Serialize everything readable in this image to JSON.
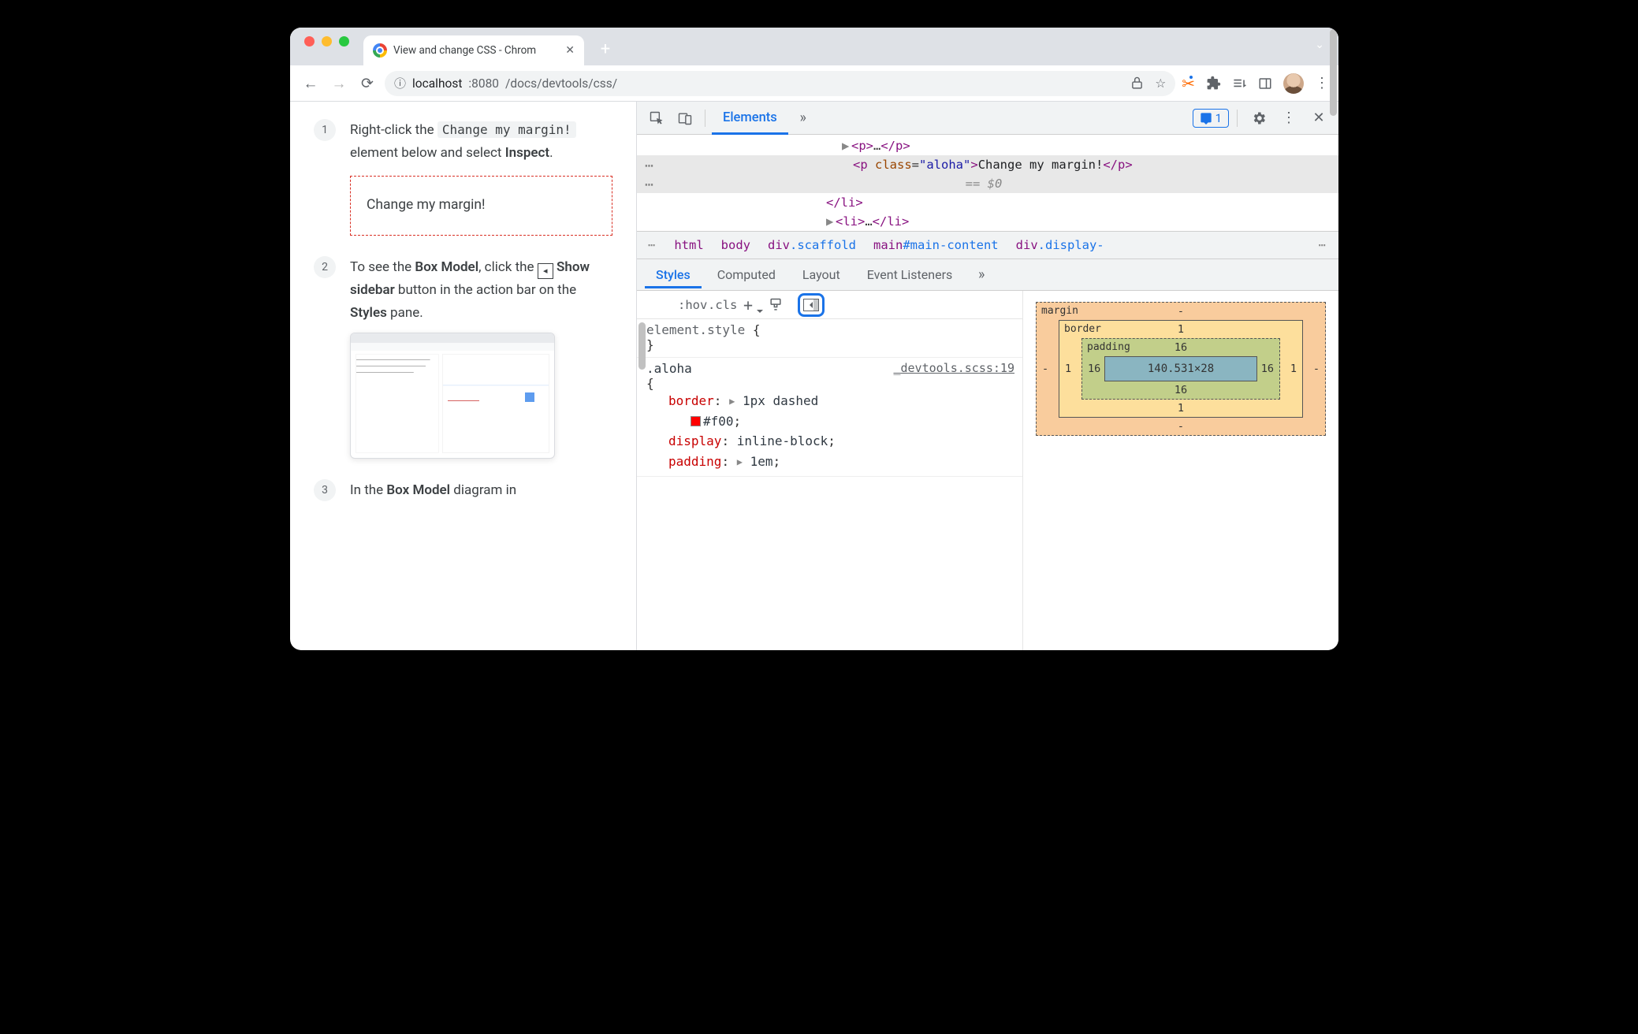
{
  "browser": {
    "tab_title": "View and change CSS - Chrom",
    "url_host": "localhost",
    "url_port": ":8080",
    "url_path": "/docs/devtools/css/"
  },
  "page": {
    "step1_a": "Right-click the ",
    "step1_code": "Change my margin!",
    "step1_b": " element below and select ",
    "step1_strong": "Inspect",
    "step1_c": ".",
    "demo_text": "Change my margin!",
    "step2_a": "To see the ",
    "step2_strong1": "Box Model",
    "step2_b": ", click the ",
    "step2_strong2": "Show sidebar",
    "step2_c": " button in the action bar on the ",
    "step2_strong3": "Styles",
    "step2_d": " pane.",
    "step3_a": "In the ",
    "step3_strong": "Box Model",
    "step3_b": " diagram in"
  },
  "devtools": {
    "main_tabs": {
      "elements": "Elements"
    },
    "issues_count": "1",
    "dom": {
      "r1": {
        "open": "<p>",
        "mid": "…",
        "close": "</p>"
      },
      "r2": {
        "open": "<p ",
        "attr": "class",
        "eq": "=",
        "val": "\"aloha\"",
        "close1": ">",
        "text": "Change my margin!",
        "close2": "</p>"
      },
      "r2b": "== $0",
      "r3": "</li>",
      "r4": {
        "open": "<li>",
        "mid": "…",
        "close": "</li>"
      }
    },
    "crumbs": {
      "c1": "html",
      "c2": "body",
      "c3_el": "div",
      "c3_cls": ".scaffold",
      "c4_el": "main",
      "c4_id": "#main-content",
      "c5_el": "div",
      "c5_cls": ".display-"
    },
    "subtabs": {
      "styles": "Styles",
      "computed": "Computed",
      "layout": "Layout",
      "listeners": "Event Listeners"
    },
    "styles_toolbar": {
      "hov": ":hov",
      "cls": ".cls"
    },
    "rules": {
      "es_sel": "element.style ",
      "es_open": "{",
      "es_close": "}",
      "aloha_sel": ".aloha ",
      "aloha_src": "_devtools.scss:19",
      "aloha_open": "{",
      "border_p": "border",
      "border_v": "1px dashed",
      "border_hex": "#f00",
      "display_p": "display",
      "display_v": "inline-block",
      "padding_p": "padding",
      "padding_v": "1em"
    },
    "boxmodel": {
      "margin_lbl": "margin",
      "margin_t": "-",
      "margin_r": "-",
      "margin_b": "-",
      "margin_l": "-",
      "border_lbl": "border",
      "border_t": "1",
      "border_r": "1",
      "border_b": "1",
      "border_l": "1",
      "padding_lbl": "padding",
      "padding_t": "16",
      "padding_r": "16",
      "padding_b": "16",
      "padding_l": "16",
      "content": "140.531×28"
    }
  }
}
